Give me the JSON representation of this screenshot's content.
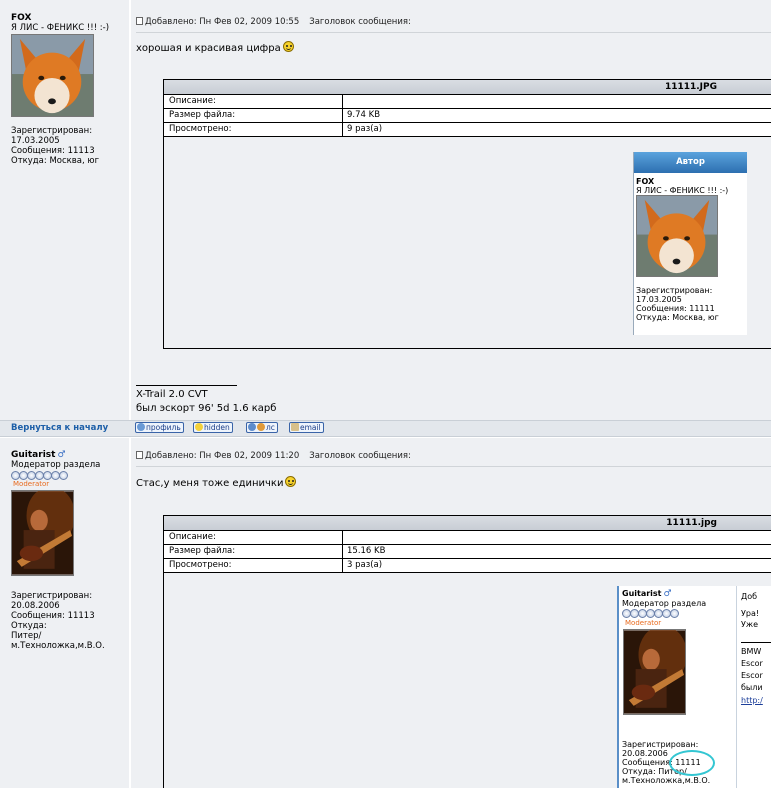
{
  "post1": {
    "username": "FOX",
    "user_title": "Я ЛИС - ФЕНИКС !!! :-)",
    "registered_label": "Зарегистрирован:",
    "registered_date": "17.03.2005",
    "posts_label": "Сообщения: 11113",
    "from_label": "Откуда: Москва, юг",
    "added": "Добавлено: Пн Фев 02, 2009 10:55",
    "subject_label": "Заголовок сообщения:",
    "message": "хорошая и красивая цифра",
    "attachment": {
      "filename": "11111.JPG",
      "desc_label": "Описание:",
      "size_label": "Размер файла:",
      "size_value": "9.74 KB",
      "views_label": "Просмотрено:",
      "views_value": "9 раз(а)"
    },
    "preview": {
      "header": "Автор",
      "username": "FOX",
      "user_title": "Я ЛИС - ФЕНИКС !!! :-)",
      "registered_label": "Зарегистрирован:",
      "registered_date": "17.03.2005",
      "posts_label": "Сообщения: 11111",
      "from_label": "Откуда: Москва, юг"
    },
    "signature_line1": "X-Trail 2.0 CVT",
    "signature_line2": "был эскорт 96' 5d 1.6 карб"
  },
  "nav": {
    "back_to_top": "Вернуться к началу",
    "profile": "профиль",
    "hidden": "hidden",
    "pm": "лс",
    "email": "email"
  },
  "post2": {
    "username": "Guitarist",
    "user_title": "Модератор раздела",
    "rank_label": "Moderator",
    "registered_label": "Зарегистрирован:",
    "registered_date": "20.08.2006",
    "posts_label": "Сообщения: 11113",
    "from_label": "Откуда:",
    "from_value": "Питер/м.Техноложка,м.В.О.",
    "added": "Добавлено: Пн Фев 02, 2009 11:20",
    "subject_label": "Заголовок сообщения:",
    "message": "Стас,у меня тоже единички",
    "attachment": {
      "filename": "11111.jpg",
      "desc_label": "Описание:",
      "size_label": "Размер файла:",
      "size_value": "15.16 KB",
      "views_label": "Просмотрено:",
      "views_value": "3 раз(а)"
    },
    "preview": {
      "username": "Guitarist",
      "user_title": "Модератор раздела",
      "rank_label": "Moderator",
      "registered_label": "Зарегистрирован:",
      "registered_date": "20.08.2006",
      "posts_label": "Сообщения: 11111",
      "from_label": "Откуда: Питер/",
      "from_value": "м.Техноложка,м.В.О.",
      "side_frag1": "Доб",
      "side_frag2": "Ура!",
      "side_frag3": "Уже",
      "side_frag4": "BMW",
      "side_frag5": "Escor",
      "side_frag6": "Escor",
      "side_frag7": "были",
      "side_frag8": "http:/"
    }
  },
  "colors": {
    "bg": "#eef0f3",
    "accent": "#2d6fb0",
    "highlight_circle": "#33c6d2"
  }
}
